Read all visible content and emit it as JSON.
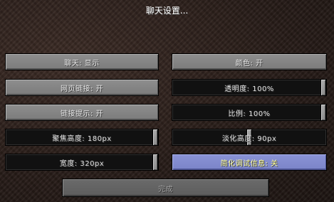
{
  "screen": {
    "title": "聊天设置..."
  },
  "options": {
    "chat": "聊天: 显示",
    "color": "颜色: 开",
    "web_links": "网页链接: 开",
    "opacity": "透明度: 100%",
    "link_prompt": "链接提示: 开",
    "scale": "比例: 100%",
    "focused_height": "聚焦高度: 180px",
    "unfocused_height": "淡化高度: 90px",
    "width": "宽度: 320px",
    "reduced_debug_info": "简化调试信息: 关"
  },
  "slider_levels": {
    "opacity": 1.0,
    "scale": 1.0,
    "focused_height": 1.0,
    "unfocused_height": 0.5,
    "width": 1.0
  },
  "done_label": "完成"
}
